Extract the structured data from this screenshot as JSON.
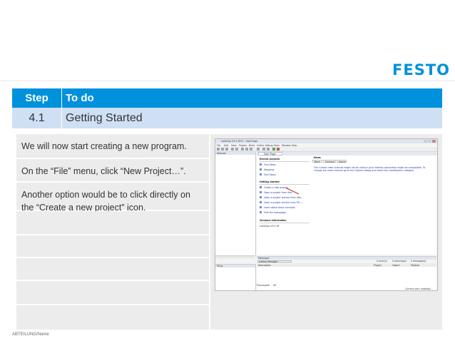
{
  "logo": "FESTO",
  "header": {
    "step_label": "Step",
    "todo_label": "To do"
  },
  "section": {
    "number": "4.1",
    "title": "Getting Started"
  },
  "steps": [
    "We will now start creating a new program.",
    "On the “File” menu, click “New Project…”.",
    "Another option would be to click directly on the “Create a new project” icon.",
    "",
    "",
    "",
    "",
    ""
  ],
  "footer": "ABTEILUNG/Name",
  "colors": {
    "brand": "#0091dc",
    "header_bg": "#0091dc",
    "subheader_bg": "#cfe0f5",
    "cell_bg": "#ececec",
    "arrow": "#c0281e"
  },
  "screenshot": {
    "window_title": "CoDeSys V3.5 SP13 - Start Page",
    "menu": [
      "File",
      "Edit",
      "View",
      "Project",
      "Build",
      "Online",
      "Debug",
      "Tools",
      "Window",
      "Help"
    ],
    "devices_title": "Devices",
    "pou_title": "POUs",
    "tab": "Start Page",
    "recent_projects": {
      "heading": "Recent projects",
      "items": [
        "First Steps",
        "Stepping",
        "First Steps"
      ]
    },
    "getting_started": {
      "heading": "Getting started",
      "items": [
        "Create a new project…",
        "Open a project from disk…",
        "Open a project archive from disk…",
        "Open a project archive from PLC…",
        "Learn about basic concepts",
        "Visit the homepage"
      ]
    },
    "version_info": {
      "heading": "Versions information",
      "text": "CoDeSys V3.5 SP"
    },
    "news": {
      "heading": "News",
      "buttons": [
        "Back",
        "Forward",
        "Home"
      ],
      "text": "The current news channel might not be valid or your internet connection might be unavailable. To change the news channel go to the Options dialog and select the LoadOptions category."
    },
    "messages": {
      "title": "Messages",
      "source": "Library Manager",
      "counts": [
        "0 error(s)",
        "0 warning(s)",
        "0 message(s)"
      ],
      "columns": [
        "Description",
        "Project",
        "Object",
        "Position"
      ],
      "precompile_label": "Precompile:",
      "precompile_status": "OK",
      "current_user": "Current user: (nobody)"
    }
  }
}
